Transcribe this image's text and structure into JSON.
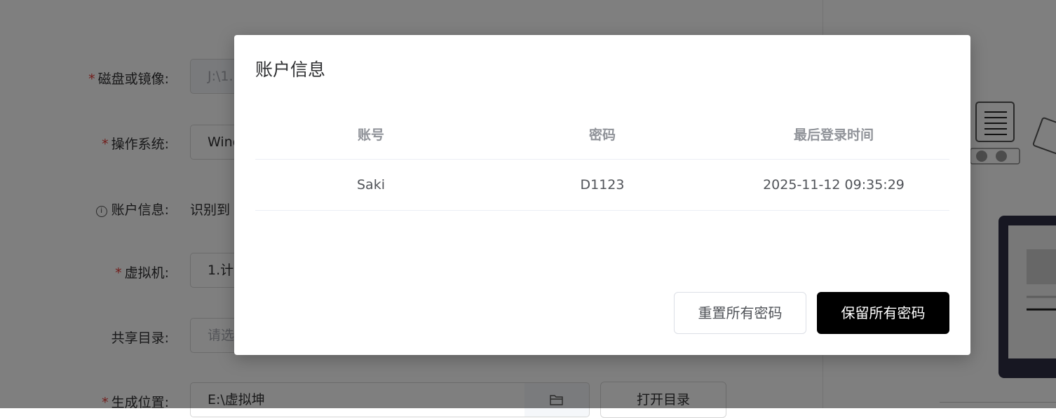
{
  "form": {
    "disk_label": "磁盘或镜像:",
    "disk_value": "J:\\1.",
    "os_label": "操作系统:",
    "os_value": "Wind",
    "account_label": "账户信息:",
    "account_value": "识别到",
    "vm_label": "虚拟机:",
    "vm_value": "1.计",
    "share_label": "共享目录:",
    "share_placeholder": "请选",
    "output_label": "生成位置:",
    "output_value": "E:\\虚拟坤",
    "open_dir_label": "打开目录",
    "required_mark": "*",
    "info_mark": "i"
  },
  "dialog": {
    "title": "账户信息",
    "columns": [
      "账号",
      "密码",
      "最后登录时间"
    ],
    "rows": [
      [
        "Saki",
        "D1123",
        "2025-11-12 09:35:29"
      ]
    ],
    "reset_button": "重置所有密码",
    "keep_button": "保留所有密码"
  },
  "colors": {
    "overlay": "rgba(0,0,0,0.5)",
    "primary_button": "#000000",
    "required": "#e53935"
  }
}
